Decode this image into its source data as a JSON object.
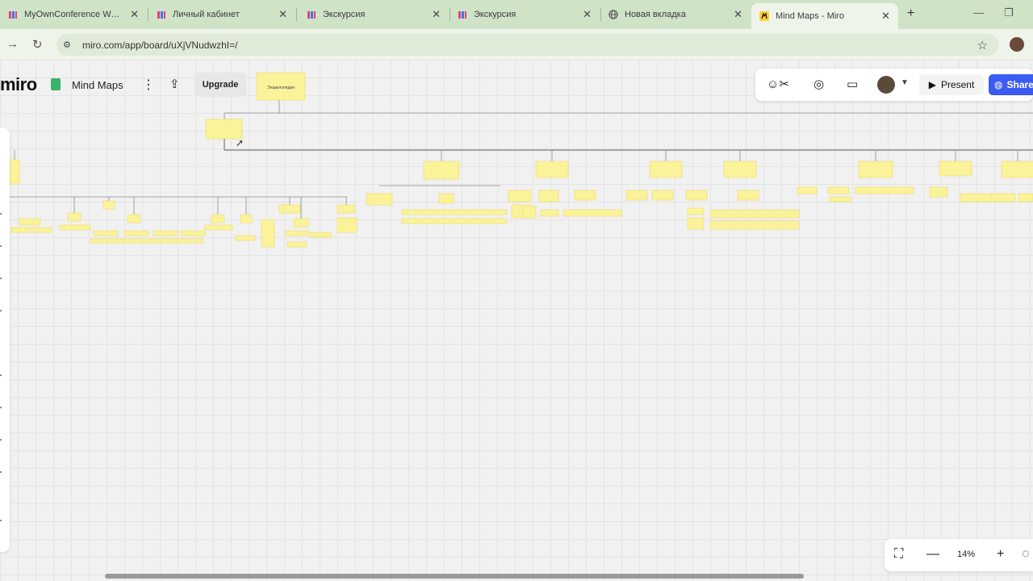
{
  "browser": {
    "tabs": [
      {
        "title": "MyOwnConference Webir",
        "favicon": "miro-logo"
      },
      {
        "title": "Личный кабинет",
        "favicon": "miro-logo"
      },
      {
        "title": "Экскурсия",
        "favicon": "miro-logo"
      },
      {
        "title": "Экскурсия",
        "favicon": "miro-logo"
      },
      {
        "title": "Новая вкладка",
        "favicon": "globe"
      },
      {
        "title": "Mind Maps - Miro",
        "favicon": "miro-logo",
        "active": true
      }
    ],
    "url": "miro.com/app/board/uXjVNudwzhI=/"
  },
  "board": {
    "logo": "miro",
    "title": "Mind Maps",
    "upgrade_label": "Upgrade",
    "present_label": "Present",
    "share_label": "Share",
    "zoom": "14%",
    "root_label": "Энциклопедия",
    "colors": {
      "sticky": "#fbf39a",
      "share": "#3c5bf0",
      "board_icon": "#3bb36a"
    }
  }
}
